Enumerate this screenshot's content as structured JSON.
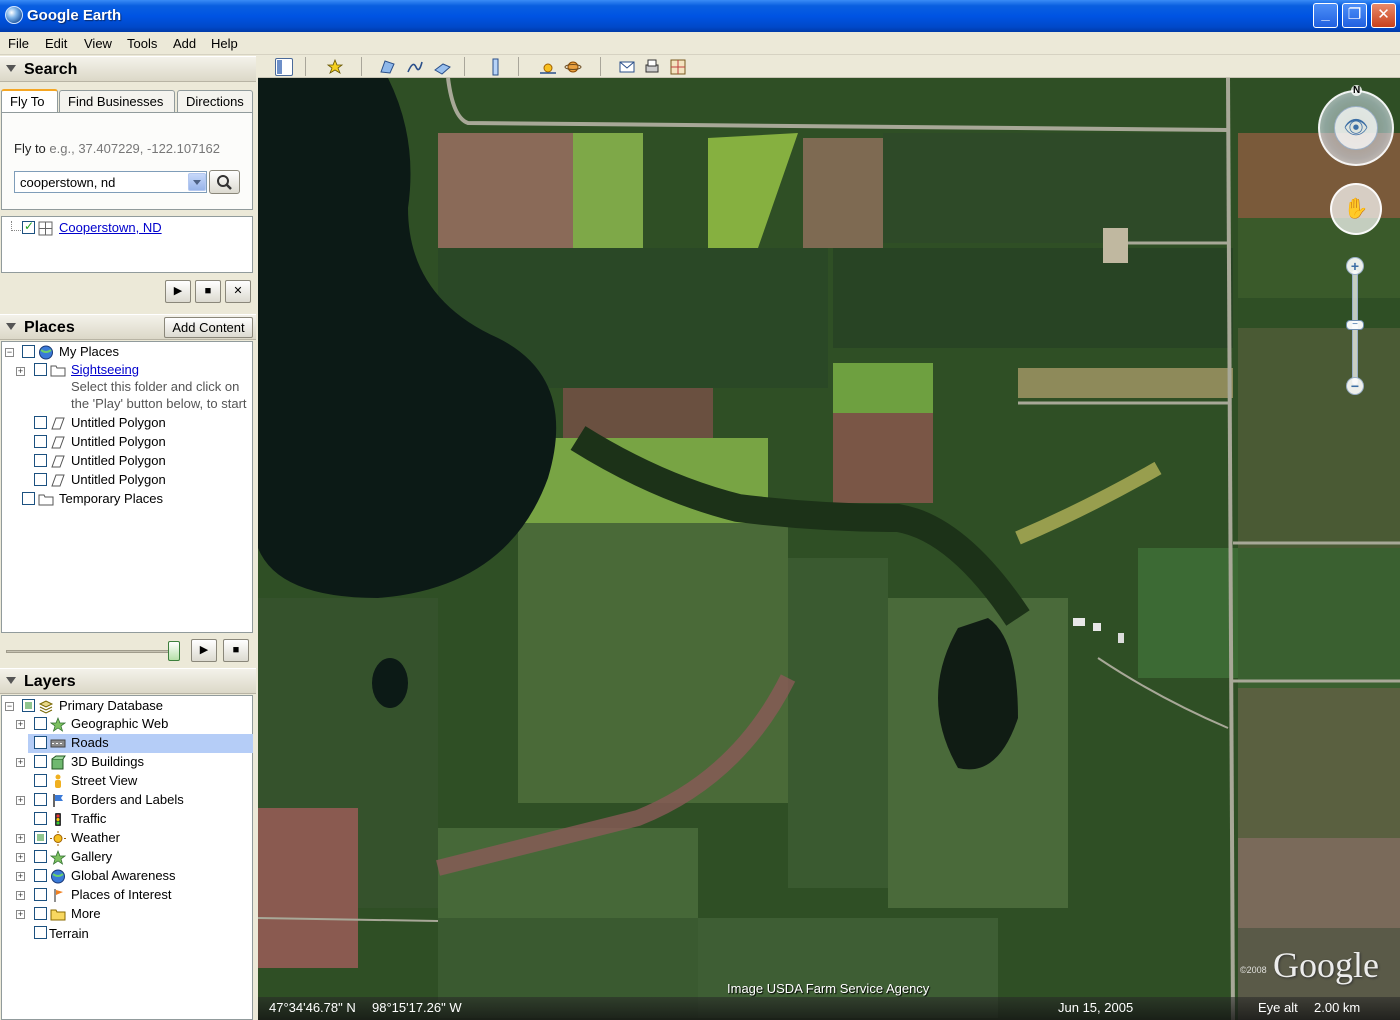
{
  "window": {
    "title": "Google Earth",
    "minimize": "_",
    "maximize": "❐",
    "close": "✕"
  },
  "menu": [
    "File",
    "Edit",
    "View",
    "Tools",
    "Add",
    "Help"
  ],
  "search": {
    "title": "Search",
    "tabs": [
      "Fly To",
      "Find Businesses",
      "Directions"
    ],
    "flyto_label": "Fly to",
    "flyto_example": "e.g., 37.407229, -122.107162",
    "query": "cooperstown, nd",
    "result": "Cooperstown, ND"
  },
  "places": {
    "title": "Places",
    "add_content": "Add Content",
    "my_places": "My Places",
    "sightseeing": "Sightseeing",
    "hint_line1": "Select this folder and click on",
    "hint_line2": "the 'Play' button below, to start",
    "polygons": [
      "Untitled Polygon",
      "Untitled Polygon",
      "Untitled Polygon",
      "Untitled Polygon"
    ],
    "temporary": "Temporary Places"
  },
  "layers": {
    "title": "Layers",
    "root": "Primary Database",
    "items": [
      {
        "label": "Geographic Web",
        "icon": "star-icon",
        "expand": true,
        "checked": false
      },
      {
        "label": "Roads",
        "icon": "road-icon",
        "expand": false,
        "checked": false,
        "selected": true
      },
      {
        "label": "3D Buildings",
        "icon": "building-icon",
        "expand": true,
        "checked": false
      },
      {
        "label": "Street View",
        "icon": "person-icon",
        "expand": false,
        "checked": false
      },
      {
        "label": "Borders and Labels",
        "icon": "flag-icon",
        "expand": true,
        "checked": false
      },
      {
        "label": "Traffic",
        "icon": "traffic-light-icon",
        "expand": false,
        "checked": false
      },
      {
        "label": "Weather",
        "icon": "sun-icon",
        "expand": true,
        "checked": true
      },
      {
        "label": "Gallery",
        "icon": "star-icon",
        "expand": true,
        "checked": false
      },
      {
        "label": "Global Awareness",
        "icon": "globe-icon",
        "expand": true,
        "checked": false
      },
      {
        "label": "Places of Interest",
        "icon": "pin-icon",
        "expand": true,
        "checked": false
      },
      {
        "label": "More",
        "icon": "folder-icon",
        "expand": true,
        "checked": false
      }
    ],
    "terrain": "Terrain"
  },
  "map": {
    "attribution": "Image USDA Farm Service Agency",
    "copyright": "©2008",
    "logo": "Google",
    "north": "N",
    "zoom_in": "+",
    "zoom_out": "−"
  },
  "status": {
    "lat": "47°34'46.78\" N",
    "lon": "98°15'17.26\" W",
    "date": "Jun 15, 2005",
    "eye_alt_label": "Eye alt",
    "eye_alt": "2.00 km"
  },
  "colors": {
    "titlebar": "#0054e3",
    "selection": "#b5cdf7",
    "link": "#0000cc"
  }
}
